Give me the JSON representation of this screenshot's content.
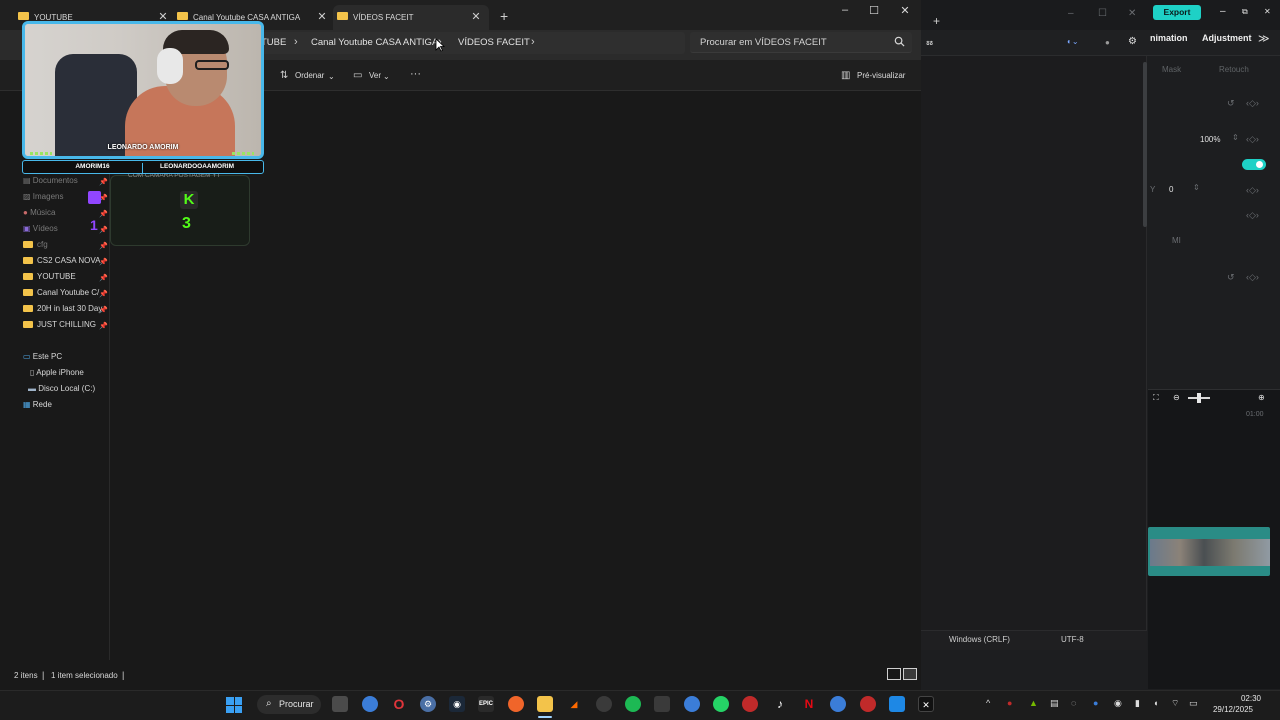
{
  "explorer": {
    "tabs": [
      {
        "label": "YOUTUBE"
      },
      {
        "label": "Canal Youtube CASA ANTIGA"
      },
      {
        "label": "VÍDEOS FACEIT"
      }
    ],
    "breadcrumb": {
      "items": [
        "TUBE",
        "Canal Youtube CASA ANTIGA",
        "VÍDEOS FACEIT"
      ]
    },
    "search": {
      "placeholder": "Procurar em VÍDEOS FACEIT"
    },
    "toolbar": {
      "sort": "Ordenar",
      "view": "Ver",
      "more": "···",
      "preview": "Pré-visualizar"
    },
    "sidebar": {
      "quick": [
        {
          "label": "Documentos"
        },
        {
          "label": "Imagens"
        },
        {
          "label": "Música"
        },
        {
          "label": "Vídeos"
        },
        {
          "label": "cfg"
        },
        {
          "label": "CS2 CASA NOVA"
        },
        {
          "label": "YOUTUBE"
        },
        {
          "label": "Canal Youtube C/"
        },
        {
          "label": "20H in last 30 Day"
        },
        {
          "label": "JUST CHILLING"
        }
      ],
      "pc": [
        {
          "label": "Este PC"
        },
        {
          "label": "Apple iPhone"
        },
        {
          "label": "Disco Local (C:)"
        },
        {
          "label": "Rede"
        }
      ]
    },
    "status": {
      "items": "2 itens",
      "selected": "1 item selecionado"
    }
  },
  "overlay": {
    "streamer_name": "LEONARDO AMORIM",
    "handle_1": "AMORIM16",
    "handle_2": "LEONARDOOAAMORIM",
    "twitch_count": "1",
    "kick_count": "3",
    "kick_letter": "K",
    "kick_labels": "COM CÂMARA    POSTAGEM YT"
  },
  "editor": {
    "export_label": "Export",
    "tabs": [
      "nimation",
      "Adjustment"
    ],
    "subtabs": [
      "Mask",
      "Retouch"
    ],
    "scale_value": "100%",
    "field_label": "Y",
    "field_value": "0",
    "mi_label": "MI",
    "timeline_time": "01:00",
    "status": {
      "line_endings": "Windows (CRLF)",
      "encoding": "UTF-8"
    }
  },
  "taskbar": {
    "search_label": "Procurar",
    "clock_time": "02:30",
    "clock_date": "29/12/2025"
  },
  "colors": {
    "accent": "#1ed1c6",
    "folder": "#f3c34a",
    "kick": "#53fc18",
    "twitch": "#9146ff",
    "webcam_border": "#48b8ea"
  }
}
